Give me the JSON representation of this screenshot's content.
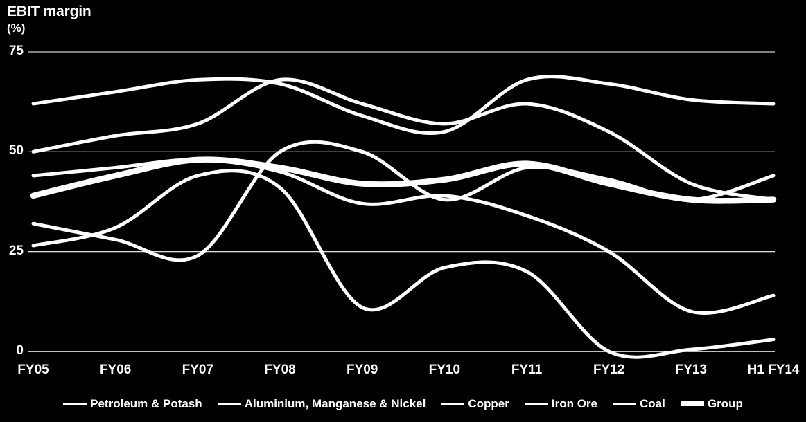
{
  "header": {
    "title": "EBIT margin",
    "unit": "(%)"
  },
  "chart_data": {
    "type": "line",
    "title": "EBIT margin",
    "subtitle": "(%)",
    "xlabel": "",
    "ylabel": "(%)",
    "ylim": [
      0,
      75
    ],
    "yticks": [
      0,
      25,
      50,
      75
    ],
    "ytick_labels": [
      "0",
      "25",
      "50",
      "75"
    ],
    "grid": true,
    "legend_position": "bottom",
    "categories": [
      "FY05",
      "FY06",
      "FY07",
      "FY08",
      "FY09",
      "FY10",
      "FY11",
      "FY12",
      "FY13",
      "H1 FY14"
    ],
    "series": [
      {
        "name": "Petroleum & Potash",
        "width": "normal",
        "values": [
          62,
          65,
          68,
          67,
          59,
          55,
          68,
          67,
          63,
          62
        ]
      },
      {
        "name": "Aluminium, Manganese & Nickel",
        "width": "normal",
        "values": [
          26.5,
          31,
          44,
          41,
          11,
          21,
          20,
          0,
          0.5,
          3
        ]
      },
      {
        "name": "Copper",
        "width": "normal",
        "values": [
          32,
          28,
          24,
          50,
          50,
          38,
          46,
          43,
          38,
          44
        ]
      },
      {
        "name": "Iron Ore",
        "width": "normal",
        "values": [
          50,
          54,
          57,
          68,
          62,
          57,
          62,
          55,
          42,
          38
        ]
      },
      {
        "name": "Coal",
        "width": "normal",
        "values": [
          44,
          46,
          48,
          45,
          37,
          39,
          34,
          25,
          10,
          14
        ]
      },
      {
        "name": "Group",
        "width": "thick",
        "values": [
          39,
          44,
          48,
          46,
          42,
          43,
          47,
          42,
          38,
          38
        ]
      }
    ]
  },
  "axis": {
    "y_labels": [
      "75",
      "50",
      "25",
      "0"
    ],
    "x_labels": [
      "FY05",
      "FY06",
      "FY07",
      "FY08",
      "FY09",
      "FY10",
      "FY11",
      "FY12",
      "FY13",
      "H1 FY14"
    ]
  },
  "legend": {
    "items": [
      {
        "label": "Petroleum & Potash",
        "width": "normal"
      },
      {
        "label": "Aluminium, Manganese & Nickel",
        "width": "normal"
      },
      {
        "label": "Copper",
        "width": "normal"
      },
      {
        "label": "Iron Ore",
        "width": "normal"
      },
      {
        "label": "Coal",
        "width": "normal"
      },
      {
        "label": "Group",
        "width": "thick"
      }
    ]
  },
  "colors": {
    "background": "#000000",
    "foreground": "#ffffff"
  }
}
